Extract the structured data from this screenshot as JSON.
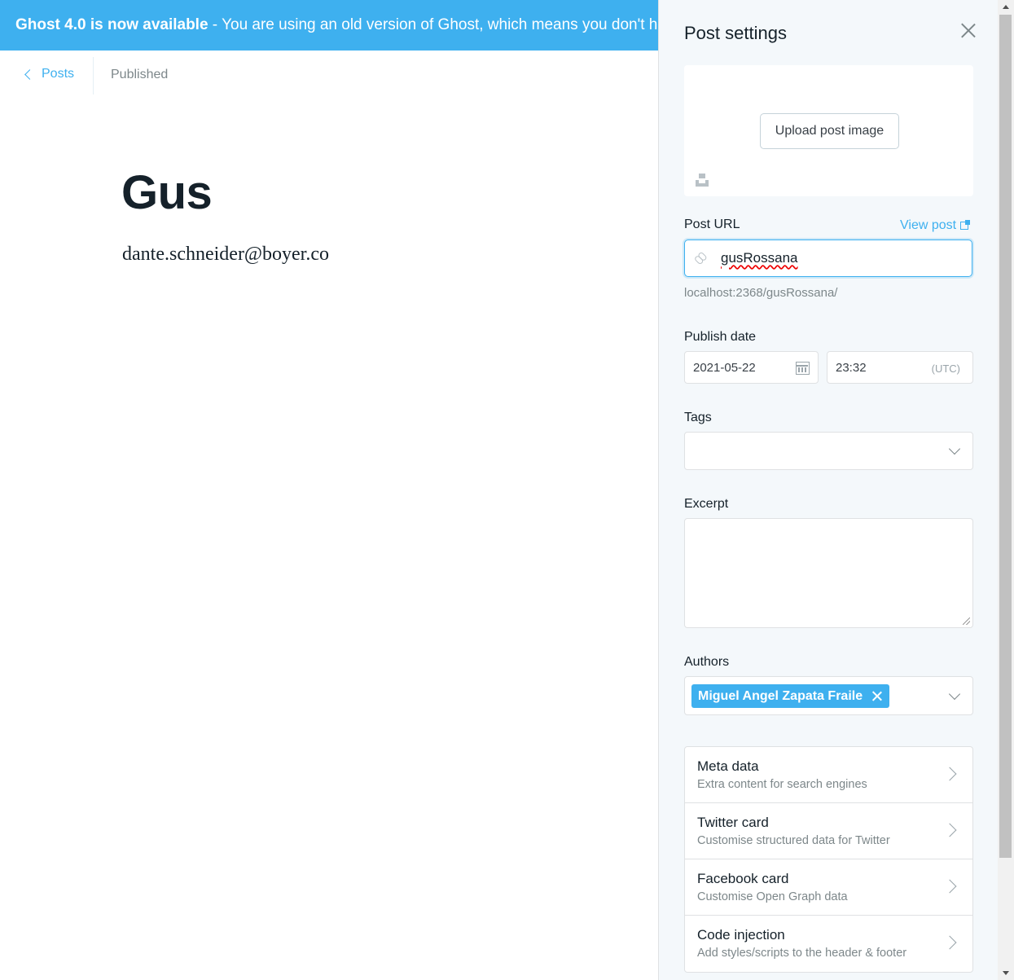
{
  "banner": {
    "title": "Ghost 4.0 is now available",
    "message": " - You are using an old version of Ghost, which means you don't have access to the latest features."
  },
  "editor": {
    "back_label": "Posts",
    "status": "Published",
    "title": "Gus",
    "body": "dante.schneider@boyer.co"
  },
  "settings": {
    "title": "Post settings",
    "upload_label": "Upload post image",
    "post_url_label": "Post URL",
    "view_post_label": "View post",
    "slug": "gusRossana",
    "url_preview": "localhost:2368/gusRossana/",
    "publish_date_label": "Publish date",
    "date": "2021-05-22",
    "time": "23:32",
    "timezone": "(UTC)",
    "tags_label": "Tags",
    "excerpt_label": "Excerpt",
    "authors_label": "Authors",
    "authors": [
      "Miguel Angel Zapata Fraile"
    ],
    "nav": [
      {
        "title": "Meta data",
        "subtitle": "Extra content for search engines"
      },
      {
        "title": "Twitter card",
        "subtitle": "Customise structured data for Twitter"
      },
      {
        "title": "Facebook card",
        "subtitle": "Customise Open Graph data"
      },
      {
        "title": "Code injection",
        "subtitle": "Add styles/scripts to the header & footer"
      }
    ]
  },
  "colors": {
    "accent": "#3eb0ef",
    "panel_bg": "#f4f8fb",
    "text": "#15212a",
    "muted": "#7d878a"
  }
}
